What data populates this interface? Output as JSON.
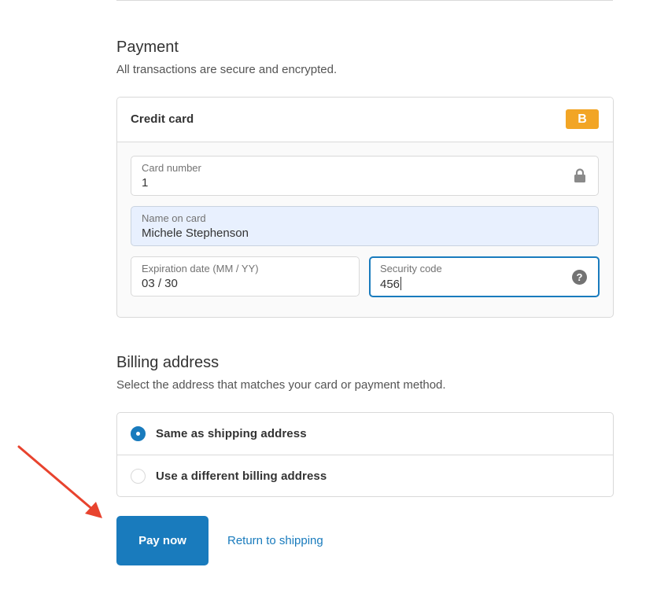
{
  "payment": {
    "title": "Payment",
    "subtitle": "All transactions are secure and encrypted.",
    "method_label": "Credit card",
    "brand_badge": "B",
    "fields": {
      "card_number": {
        "label": "Card number",
        "value": "1",
        "icon": "lock-icon"
      },
      "name_on_card": {
        "label": "Name on card",
        "value": "Michele Stephenson"
      },
      "expiration": {
        "label": "Expiration date (MM / YY)",
        "value": "03 / 30"
      },
      "security_code": {
        "label": "Security code",
        "value": "456",
        "icon": "help-icon",
        "help_glyph": "?"
      }
    }
  },
  "billing": {
    "title": "Billing address",
    "subtitle": "Select the address that matches your card or payment method.",
    "options": [
      {
        "label": "Same as shipping address",
        "selected": true
      },
      {
        "label": "Use a different billing address",
        "selected": false
      }
    ]
  },
  "actions": {
    "pay_label": "Pay now",
    "return_label": "Return to shipping"
  },
  "colors": {
    "accent": "#197bbd",
    "badge": "#f2a525",
    "annotation_arrow": "#e8432e",
    "autofill_bg": "#e8f0fe"
  }
}
